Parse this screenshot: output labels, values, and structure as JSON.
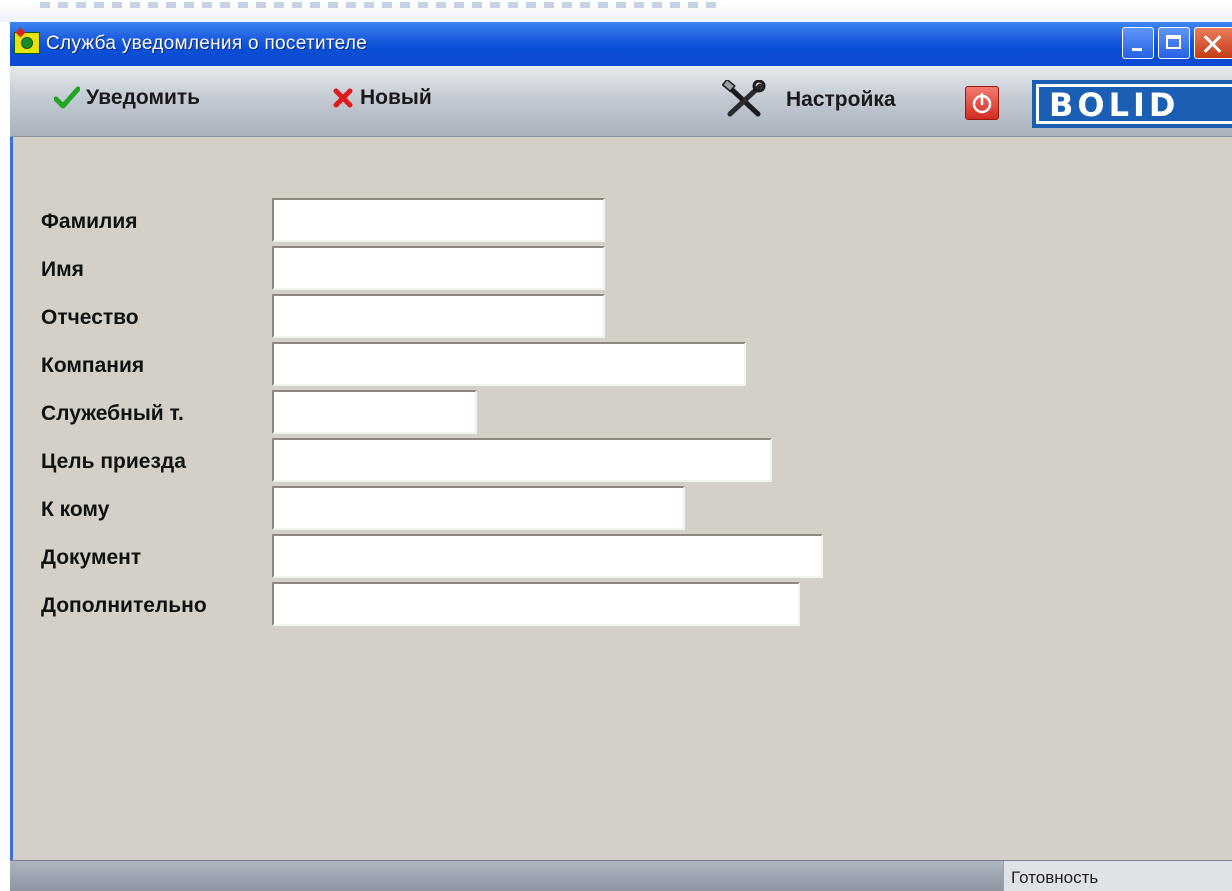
{
  "window": {
    "title": "Служба уведомления о посетителе",
    "app_icon": "visitor-service-icon"
  },
  "toolbar": {
    "notify_label": "Уведомить",
    "notify_icon": "check-icon",
    "new_label": "Новый",
    "new_icon": "x-icon",
    "settings_label": "Настройка",
    "settings_icon": "tools-icon",
    "power_icon": "power-icon",
    "logo_text": "BOLID"
  },
  "form": {
    "fields": [
      {
        "label": "Фамилия",
        "value": ""
      },
      {
        "label": "Имя",
        "value": ""
      },
      {
        "label": "Отчество",
        "value": ""
      },
      {
        "label": "Компания",
        "value": ""
      },
      {
        "label": "Служебный т.",
        "value": ""
      },
      {
        "label": "Цель приезда",
        "value": ""
      },
      {
        "label": "К кому",
        "value": ""
      },
      {
        "label": "Документ",
        "value": ""
      },
      {
        "label": "Дополнительно",
        "value": ""
      }
    ]
  },
  "statusbar": {
    "status": "Готовность"
  },
  "colors": {
    "titlebar": "#0a4fd7",
    "window_bg": "#d4d0c8",
    "check": "#22a622",
    "cross": "#e01b1b",
    "power": "#d22b21",
    "logo_bg": "#1a5fb4"
  }
}
